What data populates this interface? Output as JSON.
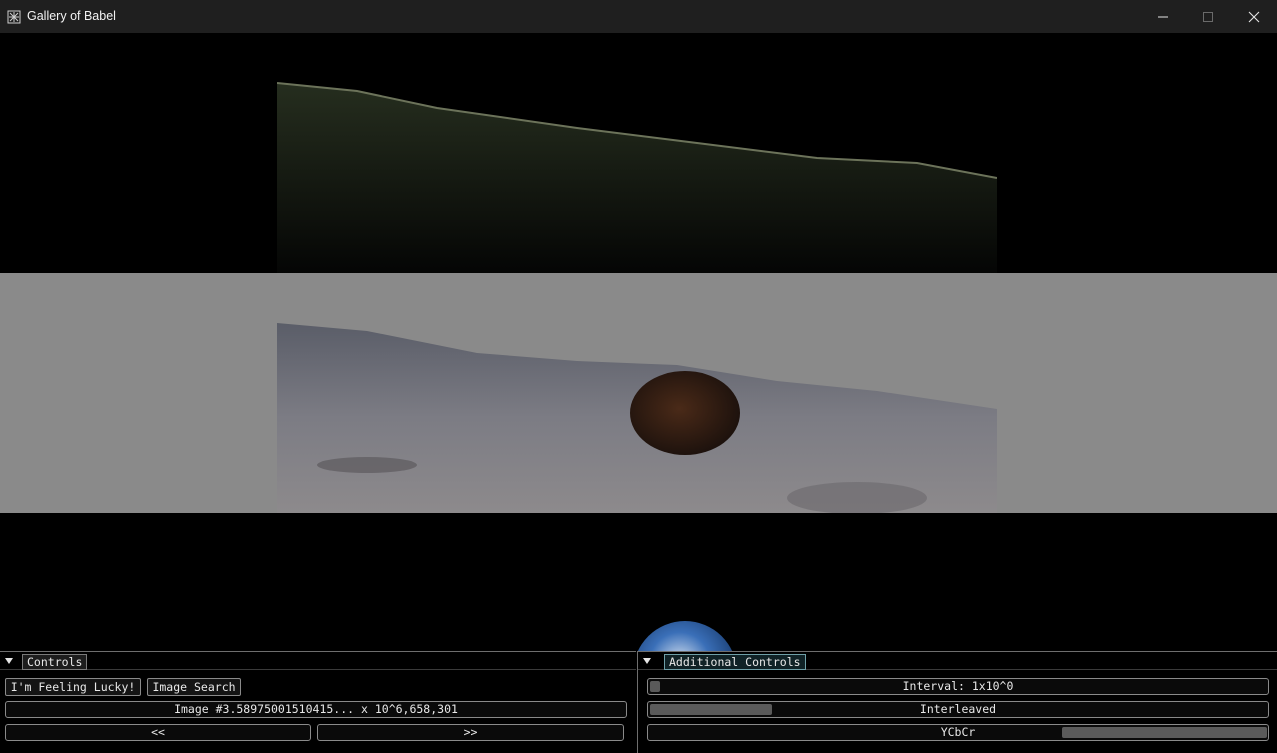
{
  "window": {
    "title": "Gallery of Babel",
    "icon": "gallery-app-icon"
  },
  "controls_panel": {
    "tab_label": "Controls",
    "feeling_lucky_label": "I'm Feeling Lucky!",
    "image_search_label": "Image Search",
    "image_index_value": "Image #3.58975001510415... x 10^6,658,301",
    "prev_label": "<<",
    "next_label": ">>"
  },
  "additional_panel": {
    "tab_label": "Additional Controls",
    "interval_label": "Interval: 1x10^0",
    "interval_level": 0.0,
    "mode_label": "Interleaved",
    "mode_level": 0.2,
    "colorspace_label": "YCbCr",
    "colorspace_level": 1.0
  },
  "colors": {
    "accent_tab": "#6fa0a8",
    "band_gray": "#8a8a8a"
  }
}
